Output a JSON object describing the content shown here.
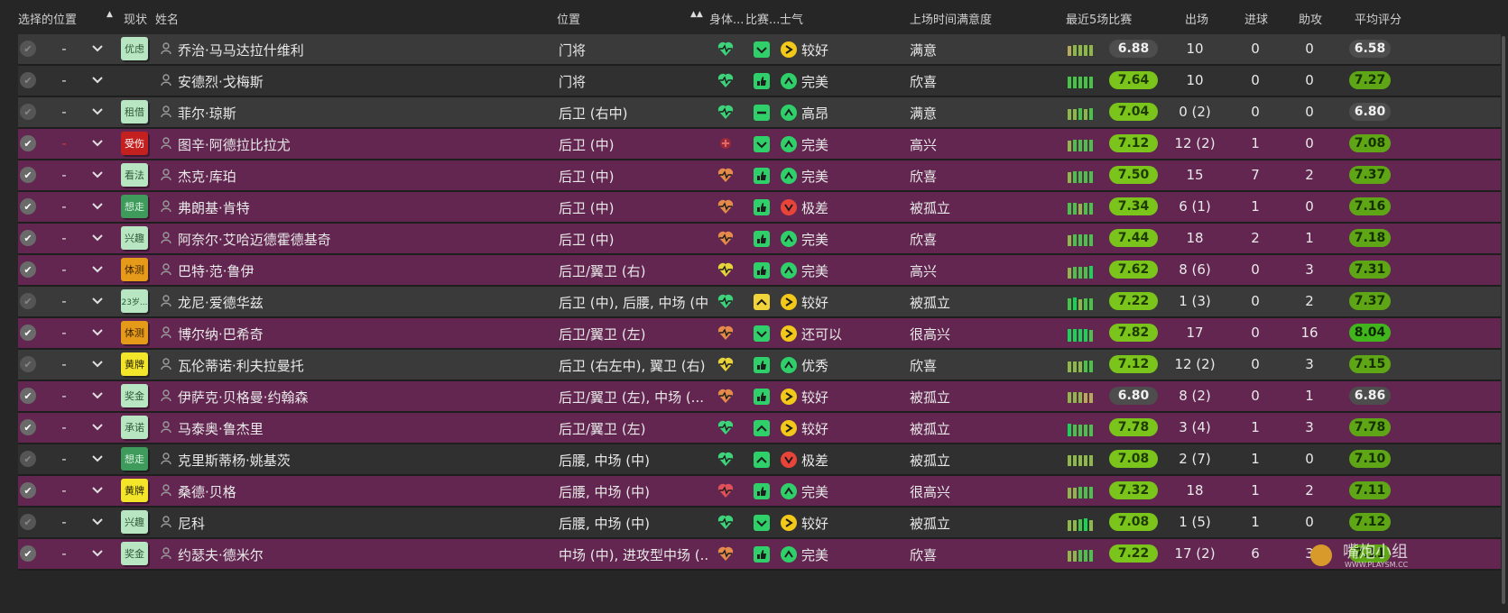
{
  "header": {
    "selected": "选择的位置",
    "status": "现状",
    "name": "姓名",
    "position": "位置",
    "condition": "身体...",
    "match": "比赛...",
    "morale": "士气",
    "satisfaction": "上场时间满意度",
    "last5": "最近5场比赛",
    "apps": "出场",
    "goals": "进球",
    "assists": "助攻",
    "avg": "平均评分"
  },
  "colors": {
    "selected_row": "#622650",
    "unselected_row": "#3a3a3a",
    "rating_green": "#7ac41b",
    "heart_green": "#3ed37a",
    "heart_orange": "#e48a4a",
    "heart_yellow": "#e6d23a"
  },
  "players": [
    {
      "sel": false,
      "dash": "-",
      "badge": "优虑",
      "badge_color": "green",
      "name": "乔治·马马达拉什维利",
      "pos": "门将",
      "heart": "green",
      "match": "check",
      "morale_icon": "yellow",
      "morale": "较好",
      "satis": "满意",
      "form": [
        2,
        3,
        3,
        3,
        3
      ],
      "form_rating": "6.88",
      "form_style": "gray",
      "apps": "10",
      "goals": "0",
      "assists": "0",
      "avg": "6.58",
      "avg_style": "gray"
    },
    {
      "sel": false,
      "dash": "-",
      "badge": "",
      "badge_color": "",
      "name": "安德烈·戈梅斯",
      "pos": "门将",
      "heart": "green",
      "match": "thumb",
      "morale_icon": "green",
      "morale": "完美",
      "satis": "欣喜",
      "form": [
        4,
        4,
        4,
        4,
        4
      ],
      "form_rating": "7.64",
      "form_style": "green",
      "apps": "10",
      "goals": "0",
      "assists": "0",
      "avg": "7.27",
      "avg_style": "green"
    },
    {
      "sel": false,
      "dash": "-",
      "badge": "租借",
      "badge_color": "green",
      "name": "菲尔·琼斯",
      "pos": "后卫 (右中)",
      "heart": "green",
      "match": "minus",
      "morale_icon": "green",
      "morale": "高昂",
      "satis": "满意",
      "form": [
        3,
        3,
        4,
        3,
        4
      ],
      "form_rating": "7.04",
      "form_style": "green",
      "apps": "0 (2)",
      "goals": "0",
      "assists": "0",
      "avg": "6.80",
      "avg_style": "gray"
    },
    {
      "sel": true,
      "dash": "-",
      "badge": "受伤",
      "badge_color": "red",
      "name": "图辛·阿德拉比拉尤",
      "pos": "后卫 (中)",
      "heart": "injury",
      "match": "check",
      "morale_icon": "green",
      "morale": "完美",
      "satis": "高兴",
      "form": [
        3,
        4,
        4,
        4,
        4
      ],
      "form_rating": "7.12",
      "form_style": "green",
      "apps": "12 (2)",
      "goals": "1",
      "assists": "0",
      "avg": "7.08",
      "avg_style": "green"
    },
    {
      "sel": true,
      "dash": "-",
      "badge": "看法",
      "badge_color": "green",
      "name": "杰克·库珀",
      "pos": "后卫 (中)",
      "heart": "orange",
      "match": "thumb",
      "morale_icon": "green",
      "morale": "完美",
      "satis": "欣喜",
      "form": [
        3,
        4,
        4,
        4,
        4
      ],
      "form_rating": "7.50",
      "form_style": "green",
      "apps": "15",
      "goals": "7",
      "assists": "2",
      "avg": "7.37",
      "avg_style": "green"
    },
    {
      "sel": true,
      "dash": "-",
      "badge": "想走",
      "badge_color": "dgreen",
      "name": "弗朗基·肯特",
      "pos": "后卫 (中)",
      "heart": "orange",
      "match": "thumb",
      "morale_icon": "red",
      "morale": "极差",
      "satis": "被孤立",
      "form": [
        4,
        4,
        3,
        4,
        4
      ],
      "form_rating": "7.34",
      "form_style": "green",
      "apps": "6 (1)",
      "goals": "1",
      "assists": "0",
      "avg": "7.16",
      "avg_style": "green"
    },
    {
      "sel": true,
      "dash": "-",
      "badge": "兴趣",
      "badge_color": "green",
      "name": "阿奈尔·艾哈迈德霍德基奇",
      "pos": "后卫 (中)",
      "heart": "orange",
      "match": "thumb",
      "morale_icon": "green",
      "morale": "完美",
      "satis": "欣喜",
      "form": [
        3,
        4,
        4,
        4,
        4
      ],
      "form_rating": "7.44",
      "form_style": "green",
      "apps": "18",
      "goals": "2",
      "assists": "1",
      "avg": "7.18",
      "avg_style": "green"
    },
    {
      "sel": true,
      "dash": "-",
      "badge": "体测",
      "badge_color": "orange",
      "name": "巴特·范·鲁伊",
      "pos": "后卫/翼卫 (右)",
      "heart": "yellow",
      "match": "thumb",
      "morale_icon": "green",
      "morale": "完美",
      "satis": "高兴",
      "form": [
        3,
        4,
        4,
        4,
        5
      ],
      "form_rating": "7.62",
      "form_style": "green",
      "apps": "8 (6)",
      "goals": "0",
      "assists": "3",
      "avg": "7.31",
      "avg_style": "green"
    },
    {
      "sel": false,
      "dash": "-",
      "badge": "23岁...",
      "badge_color": "mint",
      "name": "龙尼·爱德华兹",
      "pos": "后卫 (中), 后腰, 中场 (中)",
      "heart": "green",
      "match": "up",
      "morale_icon": "yellow",
      "morale": "较好",
      "satis": "被孤立",
      "form": [
        4,
        5,
        3,
        4,
        4
      ],
      "form_rating": "7.22",
      "form_style": "green",
      "apps": "1 (3)",
      "goals": "0",
      "assists": "2",
      "avg": "7.37",
      "avg_style": "green"
    },
    {
      "sel": true,
      "dash": "-",
      "badge": "体测",
      "badge_color": "orange",
      "name": "博尔纳·巴希奇",
      "pos": "后卫/翼卫 (左)",
      "heart": "orange",
      "match": "check",
      "morale_icon": "yellow",
      "morale": "还可以",
      "satis": "很高兴",
      "form": [
        5,
        5,
        5,
        5,
        4
      ],
      "form_rating": "7.82",
      "form_style": "green",
      "apps": "17",
      "goals": "0",
      "assists": "16",
      "avg": "8.04",
      "avg_style": "top"
    },
    {
      "sel": false,
      "dash": "-",
      "badge": "黄牌",
      "badge_color": "yellow",
      "name": "瓦伦蒂诺·利夫拉曼托",
      "pos": "后卫 (右左中), 翼卫 (右)",
      "heart": "yellow",
      "match": "thumb",
      "morale_icon": "green",
      "morale": "优秀",
      "satis": "欣喜",
      "form": [
        3,
        3,
        3,
        4,
        4
      ],
      "form_rating": "7.12",
      "form_style": "green",
      "apps": "12 (2)",
      "goals": "0",
      "assists": "3",
      "avg": "7.15",
      "avg_style": "green"
    },
    {
      "sel": true,
      "dash": "-",
      "badge": "奖金",
      "badge_color": "green",
      "name": "伊萨克·贝格曼·约翰森",
      "pos": "后卫/翼卫 (左), 中场 (...",
      "heart": "orange",
      "match": "thumb",
      "morale_icon": "yellow",
      "morale": "较好",
      "satis": "被孤立",
      "form": [
        3,
        3,
        3,
        2,
        2
      ],
      "form_rating": "6.80",
      "form_style": "gray",
      "apps": "8 (2)",
      "goals": "0",
      "assists": "1",
      "avg": "6.86",
      "avg_style": "gray"
    },
    {
      "sel": true,
      "dash": "-",
      "badge": "承诺",
      "badge_color": "green",
      "name": "马泰奥·鲁杰里",
      "pos": "后卫/翼卫 (左)",
      "heart": "green",
      "match": "up",
      "morale_icon": "yellow",
      "morale": "较好",
      "satis": "被孤立",
      "form": [
        5,
        4,
        4,
        4,
        4
      ],
      "form_rating": "7.78",
      "form_style": "green",
      "apps": "3 (4)",
      "goals": "1",
      "assists": "3",
      "avg": "7.78",
      "avg_style": "green"
    },
    {
      "sel": false,
      "dash": "-",
      "badge": "想走",
      "badge_color": "dgreen",
      "name": "克里斯蒂杨·姚基茨",
      "pos": "后腰, 中场 (中)",
      "heart": "green",
      "match": "up",
      "morale_icon": "red",
      "morale": "极差",
      "satis": "被孤立",
      "form": [
        3,
        3,
        3,
        3,
        3
      ],
      "form_rating": "7.08",
      "form_style": "green",
      "apps": "2 (7)",
      "goals": "1",
      "assists": "0",
      "avg": "7.10",
      "avg_style": "green"
    },
    {
      "sel": true,
      "dash": "-",
      "badge": "黄牌",
      "badge_color": "yellow",
      "name": "桑德·贝格",
      "pos": "后腰, 中场 (中)",
      "heart": "red",
      "match": "thumb",
      "morale_icon": "green",
      "morale": "完美",
      "satis": "很高兴",
      "form": [
        3,
        3,
        4,
        4,
        4
      ],
      "form_rating": "7.32",
      "form_style": "green",
      "apps": "18",
      "goals": "1",
      "assists": "2",
      "avg": "7.11",
      "avg_style": "green"
    },
    {
      "sel": false,
      "dash": "-",
      "badge": "兴趣",
      "badge_color": "green",
      "name": "尼科",
      "pos": "后腰, 中场 (中)",
      "heart": "green",
      "match": "check",
      "morale_icon": "yellow",
      "morale": "较好",
      "satis": "被孤立",
      "form": [
        3,
        3,
        4,
        5,
        3
      ],
      "form_rating": "7.08",
      "form_style": "green",
      "apps": "1 (5)",
      "goals": "1",
      "assists": "0",
      "avg": "7.12",
      "avg_style": "green"
    },
    {
      "sel": true,
      "dash": "-",
      "badge": "奖金",
      "badge_color": "green",
      "name": "约瑟夫·德米尔",
      "pos": "中场 (中), 进攻型中场 (...",
      "heart": "orange",
      "match": "thumb",
      "morale_icon": "green",
      "morale": "完美",
      "satis": "欣喜",
      "form": [
        3,
        3,
        4,
        4,
        4
      ],
      "form_rating": "7.22",
      "form_style": "green",
      "apps": "17 (2)",
      "goals": "6",
      "assists": "3",
      "avg": "7.11",
      "avg_style": "green"
    }
  ],
  "watermark": {
    "title": "嘴炮小组",
    "site": "WWW.PLAYSM.CC"
  }
}
